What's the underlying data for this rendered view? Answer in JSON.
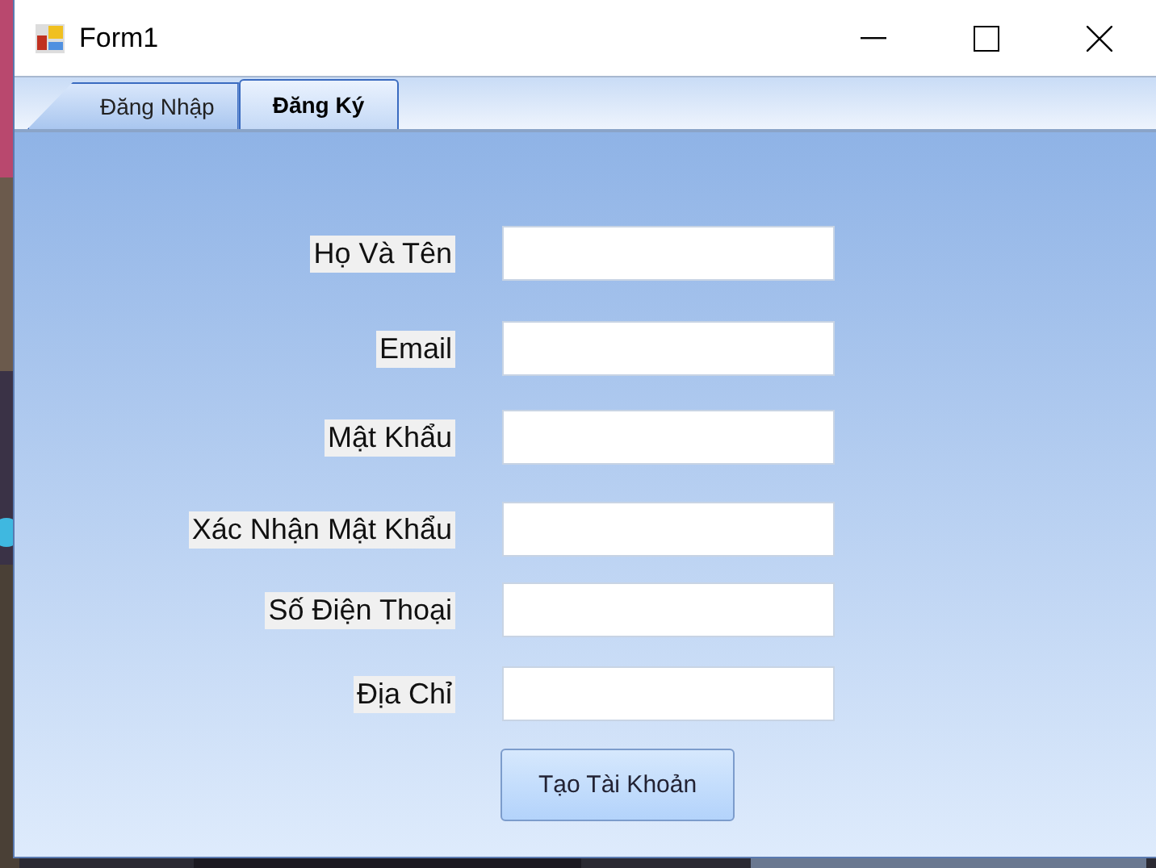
{
  "window": {
    "title": "Form1"
  },
  "tabs": [
    {
      "label": "Đăng Nhập",
      "selected": false
    },
    {
      "label": "Đăng Ký",
      "selected": true
    }
  ],
  "form": {
    "fields": [
      {
        "label": "Họ Và Tên"
      },
      {
        "label": "Email"
      },
      {
        "label": "Mật Khẩu"
      },
      {
        "label": "Xác Nhận Mật Khẩu"
      },
      {
        "label": "Số Điện Thoại"
      },
      {
        "label": "Địa Chỉ"
      }
    ],
    "button": "Tạo Tài Khoản"
  }
}
